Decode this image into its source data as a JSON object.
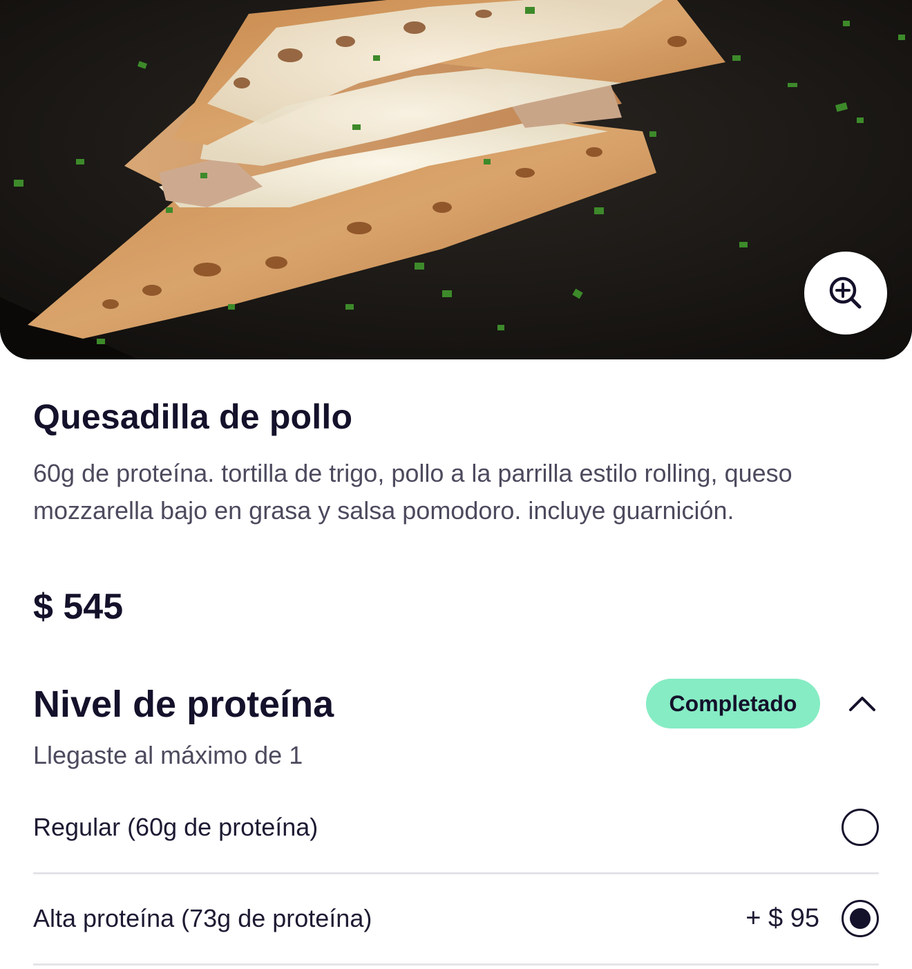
{
  "product": {
    "image_description_icon": "food-photo",
    "zoom_icon": "zoom-in-icon",
    "name": "Quesadilla de pollo",
    "description": "60g de proteína. tortilla de trigo, pollo a la parrilla estilo rolling, queso mozzarella bajo en grasa y salsa pomodoro. incluye guarnición.",
    "price": "$ 545"
  },
  "section": {
    "title": "Nivel de proteína",
    "status_badge": "Completado",
    "status_color": "#86ecc4",
    "subtitle": "Llegaste al máximo de 1",
    "collapse_icon": "chevron-up-icon",
    "options": [
      {
        "label": "Regular (60g de proteína)",
        "extra_price": "",
        "selected": false
      },
      {
        "label": "Alta proteína (73g de proteína)",
        "extra_price": "+ $ 95",
        "selected": true
      }
    ]
  },
  "colors": {
    "text_primary": "#14112b",
    "text_secondary": "#4d4a5e",
    "divider": "#e4e3e8"
  }
}
